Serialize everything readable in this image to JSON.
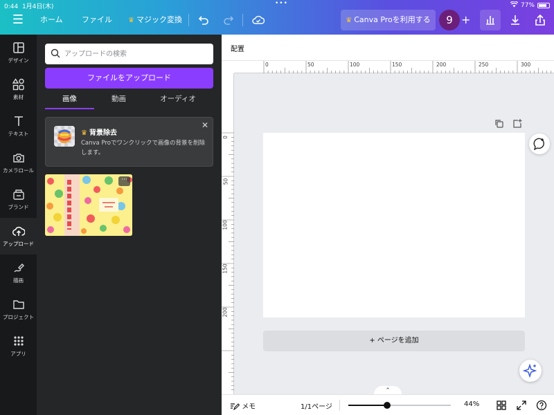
{
  "status_bar": {
    "time": "0:44",
    "date": "1月4日(木)",
    "battery": "77%"
  },
  "header": {
    "home": "ホーム",
    "file": "ファイル",
    "magic": "マジック変換",
    "pro_button": "Canva Proを利用する",
    "avatar_number": "9",
    "plus": "+"
  },
  "leftnav": {
    "items": [
      {
        "label": "デザイン",
        "icon": "layout-icon"
      },
      {
        "label": "素材",
        "icon": "shapes-icon"
      },
      {
        "label": "テキスト",
        "icon": "text-icon"
      },
      {
        "label": "カメラロール",
        "icon": "camera-icon"
      },
      {
        "label": "ブランド",
        "icon": "brand-icon"
      },
      {
        "label": "アップロード",
        "icon": "cloud-upload-icon"
      },
      {
        "label": "描画",
        "icon": "draw-icon"
      },
      {
        "label": "プロジェクト",
        "icon": "folder-icon"
      },
      {
        "label": "アプリ",
        "icon": "apps-grid-icon"
      }
    ],
    "active_index": 5
  },
  "panel": {
    "search_placeholder": "アップロードの検索",
    "upload_button": "ファイルをアップロード",
    "tabs": [
      "画像",
      "動画",
      "オーディオ"
    ],
    "active_tab": 0,
    "bg_remove": {
      "title": "背景除去",
      "description": "Canva Proでワンクリックで画像の背景を削除します。"
    },
    "thumb_more": "···"
  },
  "main": {
    "position_label": "配置",
    "ruler_top": [
      "0",
      "50",
      "100",
      "150",
      "200",
      "250",
      "300"
    ],
    "ruler_left": [
      "0",
      "50",
      "100",
      "150",
      "200"
    ],
    "add_page": "+ ページを追加"
  },
  "bottombar": {
    "memo": "メモ",
    "page_indicator": "1/1ページ",
    "zoom": "44%",
    "zoom_fraction": 0.38
  },
  "colors": {
    "accent": "#8b3dff",
    "avatar": "#6b1f7a",
    "sidebar": "#18191b",
    "panel": "#252627"
  }
}
